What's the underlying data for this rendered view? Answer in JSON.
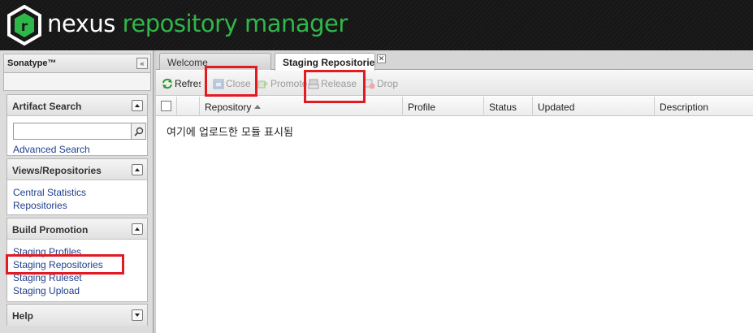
{
  "header": {
    "brand_word1": "nexus",
    "brand_word2": " repository manager",
    "logo_letter": "r"
  },
  "sidebar": {
    "title": "Sonatype™",
    "collapse_glyph": "«",
    "panels": {
      "artifact_search": {
        "title": "Artifact Search",
        "search_value": "",
        "links": [
          "Advanced Search"
        ]
      },
      "views_repositories": {
        "title": "Views/Repositories",
        "links": [
          "Central Statistics",
          "Repositories"
        ]
      },
      "build_promotion": {
        "title": "Build Promotion",
        "links": [
          "Staging Profiles",
          "Staging Repositories",
          "Staging Ruleset",
          "Staging Upload"
        ]
      },
      "help": {
        "title": "Help"
      }
    }
  },
  "tabs": [
    {
      "label": "Welcome",
      "active": false
    },
    {
      "label": "Staging Repositories",
      "active": true
    }
  ],
  "toolbar": {
    "refresh": "Refresh",
    "close": "Close",
    "promote": "Promote",
    "release": "Release",
    "drop": "Drop"
  },
  "grid": {
    "columns": [
      "Repository",
      "Profile",
      "Status",
      "Updated",
      "Description"
    ],
    "sorted_column": "Repository",
    "sort_direction": "asc",
    "empty_message": "여기에 업로드한 모듈 표시됨"
  },
  "colors": {
    "highlight": "#e21a22",
    "brand_green": "#2fb84a",
    "link": "#1f3f8c"
  }
}
